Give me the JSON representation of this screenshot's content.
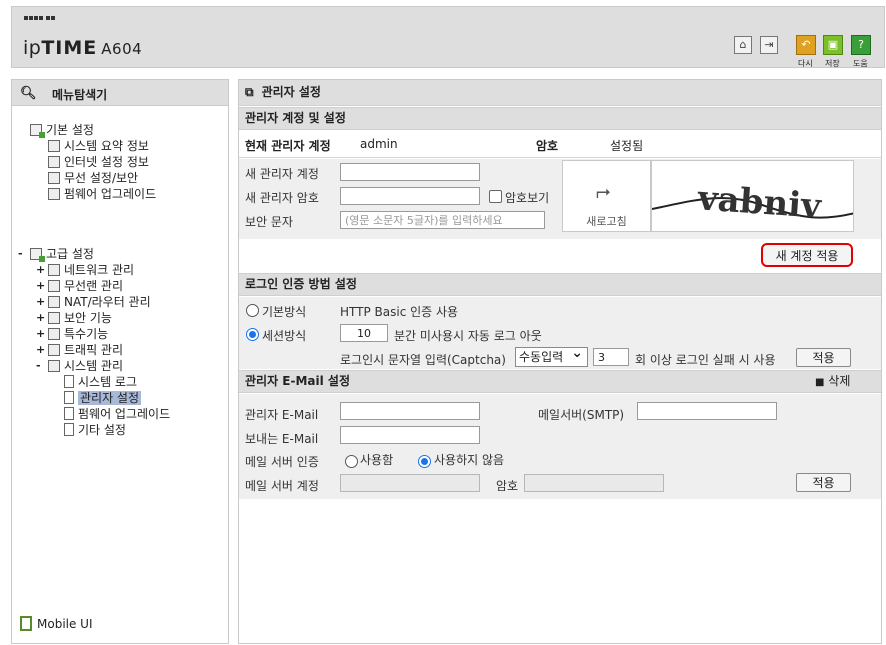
{
  "header": {
    "brand_prefix": "ip",
    "brand_main": "TIME",
    "model": "A604",
    "buttons": [
      {
        "icon": "home-icon"
      },
      {
        "icon": "logout-icon"
      },
      {
        "icon": "back-icon",
        "caption": "다시",
        "color": "#e0a020"
      },
      {
        "icon": "save-icon",
        "caption": "저장",
        "color": "#7cbf2a"
      },
      {
        "icon": "help-icon",
        "caption": "도움",
        "color": "#3a9e3a"
      }
    ]
  },
  "sidebar": {
    "title": "메뉴탐색기",
    "basic": {
      "label": "기본 설정",
      "items": [
        {
          "label": "시스템 요약 정보"
        },
        {
          "label": "인터넷 설정 정보"
        },
        {
          "label": "무선 설정/보안"
        },
        {
          "label": "펌웨어 업그레이드"
        }
      ]
    },
    "advanced": {
      "toggle": "-",
      "label": "고급 설정",
      "groups": [
        {
          "toggle": "+",
          "label": "네트워크 관리"
        },
        {
          "toggle": "+",
          "label": "무선랜 관리"
        },
        {
          "toggle": "+",
          "label": "NAT/라우터 관리"
        },
        {
          "toggle": "+",
          "label": "보안 기능"
        },
        {
          "toggle": "+",
          "label": "특수기능"
        },
        {
          "toggle": "+",
          "label": "트래픽 관리"
        },
        {
          "toggle": "-",
          "label": "시스템 관리"
        }
      ],
      "system_items": [
        {
          "label": "시스템 로그"
        },
        {
          "label": "관리자 설정"
        },
        {
          "label": "펌웨어 업그레이드"
        },
        {
          "label": "기타 설정"
        }
      ]
    },
    "mobile": "Mobile UI"
  },
  "main": {
    "title": "관리자 설정",
    "account": {
      "section_title": "관리자 계정 및 설정",
      "current_label": "현재 관리자 계정",
      "current_value": "admin",
      "password_label": "암호",
      "password_status": "설정됨",
      "new_account_label": "새 관리자 계정",
      "new_account_value": "",
      "new_password_label": "새 관리자 암호",
      "new_password_value": "",
      "show_password_label": "암호보기",
      "captcha_label": "보안 문자",
      "captcha_placeholder": "(영문 소문자 5글자)를 입력하세요",
      "refresh_label": "새로고침",
      "captcha_image_text": "vabniv",
      "apply_label": "새 계정 적용"
    },
    "login": {
      "section_title": "로그인 인증 방법 설정",
      "basic_label": "기본방식",
      "basic_desc": "HTTP Basic 인증 사용",
      "session_label": "세션방식",
      "selected": "session",
      "timeout_value": "10",
      "timeout_desc": "분간 미사용시 자동 로그 아웃",
      "captcha_label": "로그인시 문자열 입력(Captcha)",
      "captcha_mode": "수동입력",
      "fail_count": "3",
      "fail_desc": "회 이상 로그인 실패 시 사용",
      "apply_label": "적용"
    },
    "email": {
      "section_title": "관리자 E-Mail 설정",
      "delete_label": "삭제",
      "admin_email_label": "관리자 E-Mail",
      "admin_email_value": "",
      "smtp_label": "메일서버(SMTP)",
      "smtp_value": "",
      "sender_label": "보내는 E-Mail",
      "sender_value": "",
      "auth_label": "메일 서버 인증",
      "auth_use": "사용함",
      "auth_not_use": "사용하지 않음",
      "auth_selected": "not_use",
      "account_label": "메일 서버 계정",
      "account_value": "",
      "password_label": "암호",
      "password_value": "",
      "apply_label": "적용"
    }
  }
}
